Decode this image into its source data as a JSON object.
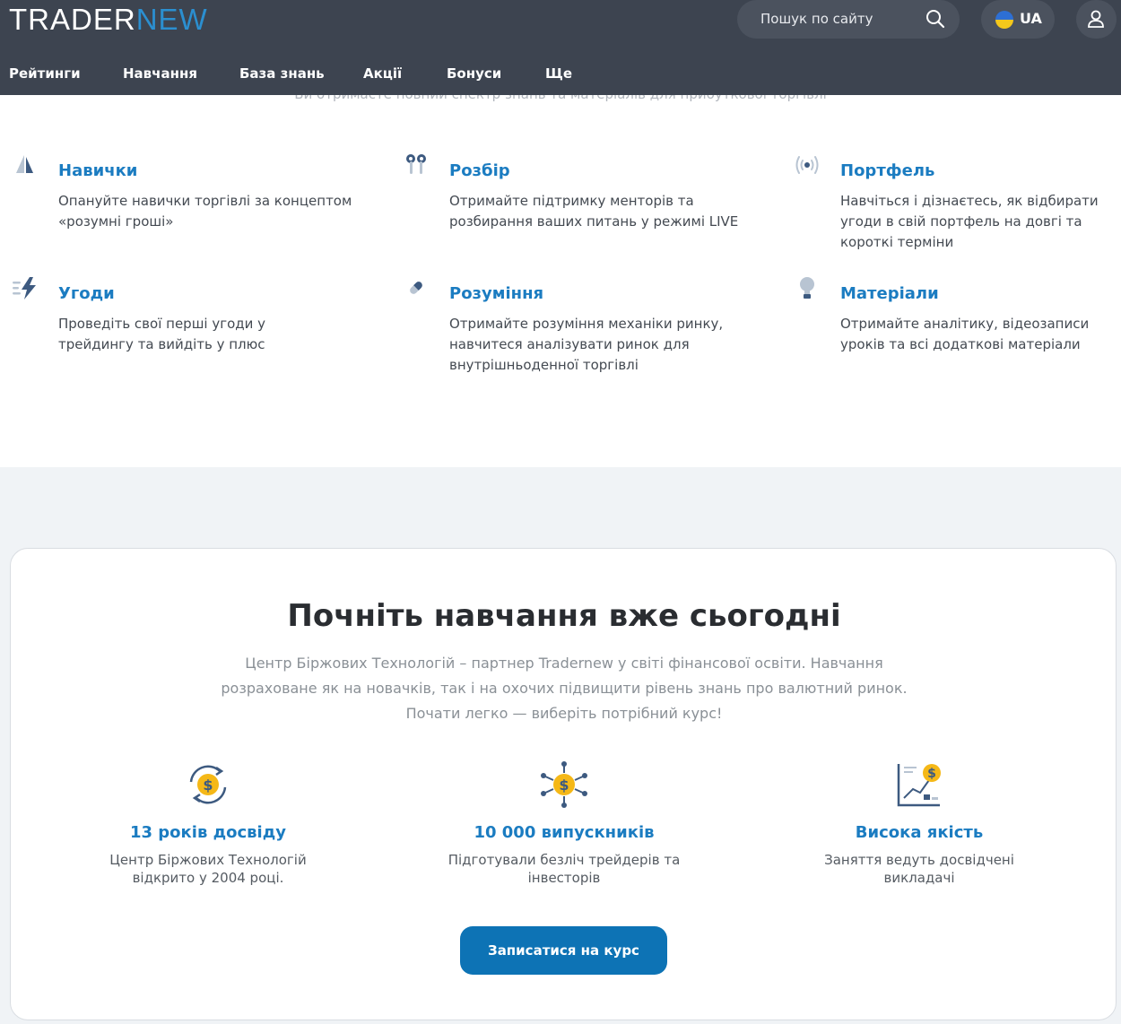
{
  "header": {
    "logo_part1": "TRADER",
    "logo_part2": "NEW",
    "search_placeholder": "Пошук по сайту",
    "language": "UA"
  },
  "nav": [
    {
      "label": "Рейтинги"
    },
    {
      "label": "Навчання"
    },
    {
      "label": "База знань"
    },
    {
      "label": "Акції"
    },
    {
      "label": "Бонуси"
    },
    {
      "label": "Ще"
    }
  ],
  "intro_partial": "Ви отримаєте повний спектр знань та матеріалів для прибуткової торгівлі",
  "features": [
    {
      "title": "Навички",
      "text": "Опануйте навички торгівлі за концептом «розумні гроші»",
      "icon": "sails-icon"
    },
    {
      "title": "Розбір",
      "text": "Отримайте підтримку менторів та розбирання ваших питань у режимі LIVE",
      "icon": "earbuds-icon"
    },
    {
      "title": "Портфель",
      "text": "Навчіться і дізнаєтесь, як відбирати угоди в свій портфель на довгі та короткі терміни",
      "icon": "broadcast-icon"
    },
    {
      "title": "Угоди",
      "text": "Проведіть свої перші угоди у трейдингу та вийдіть у плюс",
      "icon": "lightning-icon"
    },
    {
      "title": "Розуміння",
      "text": "Отримайте розуміння механіки ринку, навчитеся аналізувати ринок для внутрішньоденної торгівлі",
      "icon": "pill-icon"
    },
    {
      "title": "Матеріали",
      "text": "Отримайте аналітику, відеозаписи уроків та всі додаткові матеріали",
      "icon": "lightbulb-icon"
    }
  ],
  "cta": {
    "title": "Почніть навчання вже сьогодні",
    "text": "Центр Біржових Технологій – партнер Tradernew у світі фінансової освіти. Навчання розраховане як на новачків, так і на охочих підвищити рівень знань про валютний ринок. Почати легко — виберіть потрібний курс!",
    "button": "Записатися на курс"
  },
  "stats": [
    {
      "title": "13 років досвіду",
      "text": "Центр Біржових Технологій відкрито у 2004 році.",
      "icon": "coin-cycle-icon"
    },
    {
      "title": "10 000 випускників",
      "text": "Підготували безліч трейдерів та інвесторів",
      "icon": "coin-network-icon"
    },
    {
      "title": "Висока якість",
      "text": "Заняття ведуть досвідчені викладачі",
      "icon": "chart-coin-icon"
    }
  ],
  "colors": {
    "header_bg": "#3d4450",
    "accent_blue": "#1b7cc1",
    "button_blue": "#0d73b5",
    "coin_yellow": "#f5b817"
  }
}
